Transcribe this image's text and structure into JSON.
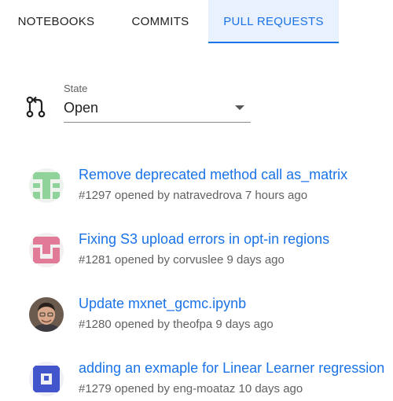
{
  "tabs": [
    {
      "label": "NOTEBOOKS",
      "active": false
    },
    {
      "label": "COMMITS",
      "active": false
    },
    {
      "label": "PULL REQUESTS",
      "active": true
    }
  ],
  "colors": {
    "accent": "#1a73e8",
    "active_tab_bg": "#e8f1fd",
    "meta_text": "#616161"
  },
  "state_filter": {
    "icon": "pull-request-icon",
    "label": "State",
    "value": "Open"
  },
  "pull_requests": [
    {
      "title": "Remove deprecated method call as_matrix",
      "meta": "#1297 opened by natravedrova 7 hours ago",
      "avatar": "identicon-green"
    },
    {
      "title": "Fixing S3 upload errors in opt-in regions",
      "meta": "#1281 opened by corvuslee 9 days ago",
      "avatar": "identicon-pink"
    },
    {
      "title": "Update mxnet_gcmc.ipynb",
      "meta": "#1280 opened by theofpa 9 days ago",
      "avatar": "user-photo"
    },
    {
      "title": "adding an exmaple for Linear Learner regression",
      "meta": "#1279 opened by eng-moataz 10 days ago",
      "avatar": "identicon-blue"
    }
  ]
}
